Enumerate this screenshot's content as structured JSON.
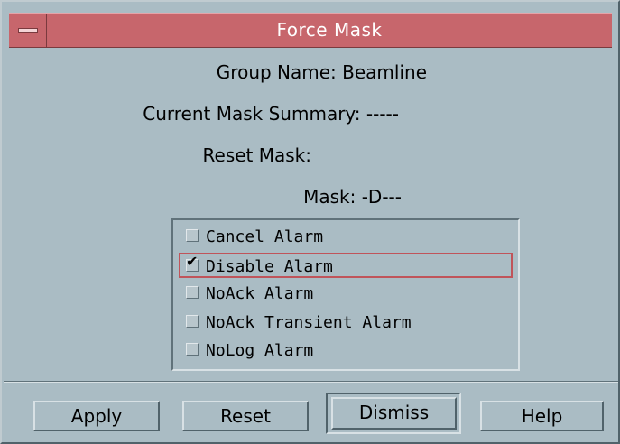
{
  "window": {
    "title": "Force Mask"
  },
  "form": {
    "group_name": "Group Name: Beamline",
    "current_mask_summary": "Current Mask Summary: -----",
    "reset_mask": "Reset Mask:",
    "mask": "Mask: -D---"
  },
  "checklist": {
    "items": [
      {
        "label": "Cancel Alarm",
        "checked": false
      },
      {
        "label": "Disable Alarm",
        "checked": true
      },
      {
        "label": "NoAck Alarm",
        "checked": false
      },
      {
        "label": "NoAck Transient Alarm",
        "checked": false
      },
      {
        "label": "NoLog Alarm",
        "checked": false
      }
    ]
  },
  "buttons": {
    "apply": "Apply",
    "reset": "Reset",
    "dismiss": "Dismiss",
    "help": "Help"
  },
  "check_mark_glyph": "✔",
  "colors": {
    "background": "#aabcc4",
    "titlebar": "#c7666c",
    "focus_border": "#c0545a"
  }
}
